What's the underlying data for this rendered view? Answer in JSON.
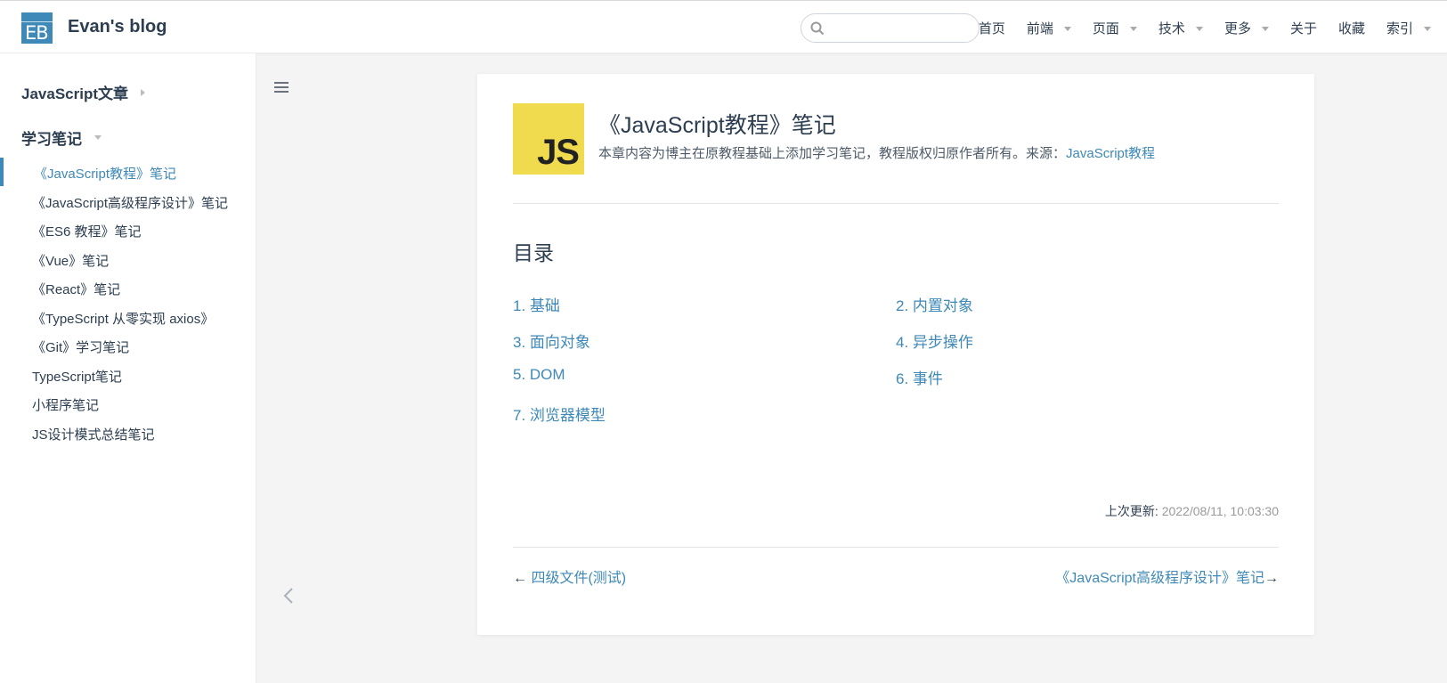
{
  "navbar": {
    "logo_text": "EB",
    "site_name": "Evan's blog",
    "search_placeholder": "",
    "links": [
      "首页",
      "前端",
      "页面",
      "技术",
      "更多",
      "关于",
      "收藏",
      "索引"
    ],
    "dropdown_links": [
      "前端",
      "页面",
      "技术",
      "更多",
      "索引"
    ]
  },
  "sidebar": {
    "group1": "JavaScript文章",
    "group2": "学习笔记",
    "items": [
      "《JavaScript教程》笔记",
      "《JavaScript高级程序设计》笔记",
      "《ES6 教程》笔记",
      "《Vue》笔记",
      "《React》笔记",
      "《TypeScript 从零实现 axios》",
      "《Git》学习笔记"
    ],
    "active_item": "《JavaScript教程》笔记",
    "top_items": [
      "TypeScript笔记",
      "小程序笔记",
      "JS设计模式总结笔记"
    ]
  },
  "article": {
    "logo_text": "JS",
    "title": "《JavaScript教程》笔记",
    "description": "本章内容为博主在原教程基础上添加学习笔记，教程版权归原作者所有。来源：",
    "source_link": "JavaScript教程",
    "toc_title": "目录",
    "toc": [
      "1. 基础",
      "2. 内置对象",
      "3. 面向对象",
      "4. 异步操作",
      "5. DOM",
      "6. 事件",
      "7. 浏览器模型"
    ],
    "last_updated_label": "上次更新:",
    "last_updated_value": "2022/08/11, 10:03:30",
    "prev_link": "四级文件(测试)",
    "next_link": "《JavaScript高级程序设计》笔记",
    "prev_arrow": "←",
    "next_arrow": "→"
  },
  "colors": {
    "accent": "#3e89b7",
    "js_yellow": "#f0db4f",
    "text": "#2c3e50"
  }
}
